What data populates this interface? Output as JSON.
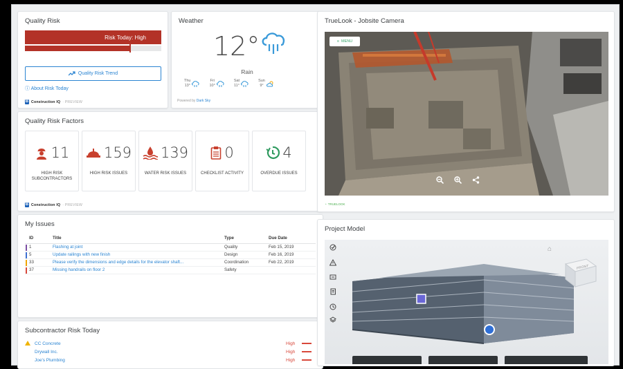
{
  "quality_risk": {
    "title": "Quality Risk",
    "risk_label": "Risk Today: High",
    "risk_level_fraction": 0.77,
    "trend_button": "Quality Risk Trend",
    "about_link": "About Risk Today",
    "footer_brand": "Construction IQ",
    "footer_tag": "· PREVIEW"
  },
  "weather": {
    "title": "Weather",
    "temperature": "12°",
    "condition": "Rain",
    "forecast": [
      {
        "day": "Thu",
        "temp": "13°",
        "icon": "rain-cloud-icon"
      },
      {
        "day": "Fri",
        "temp": "10°",
        "icon": "rain-cloud-icon"
      },
      {
        "day": "Sat",
        "temp": "11°",
        "icon": "rain-cloud-icon"
      },
      {
        "day": "Sun",
        "temp": "9°",
        "icon": "partly-cloudy-icon"
      }
    ],
    "powered_prefix": "Powered by",
    "powered_brand": "Dark Sky"
  },
  "risk_factors": {
    "title": "Quality Risk Factors",
    "items": [
      {
        "value": "11",
        "label": "HIGH RISK SUBCONTRACTORS",
        "icon": "worker-icon"
      },
      {
        "value": "159",
        "label": "HIGH RISK ISSUES",
        "icon": "hard-hat-icon"
      },
      {
        "value": "139",
        "label": "WATER RISK ISSUES",
        "icon": "water-risk-icon"
      },
      {
        "value": "0",
        "label": "CHECKLIST ACTIVITY",
        "icon": "clipboard-icon"
      },
      {
        "value": "4",
        "label": "OVERDUE ISSUES",
        "icon": "overdue-icon"
      }
    ],
    "footer_brand": "Construction IQ",
    "footer_tag": "· PREVIEW"
  },
  "camera": {
    "title": "TrueLook - Jobsite Camera",
    "menu_label": "MENU",
    "footer_brand": "TRUELOOK"
  },
  "my_issues": {
    "title": "My Issues",
    "columns": [
      "ID",
      "Title",
      "Type",
      "Due Date"
    ],
    "rows": [
      {
        "id": "1",
        "title": "Flashing at joint",
        "type": "Quality",
        "due": "Feb 15, 2019",
        "color": "#7b4ea3"
      },
      {
        "id": "5",
        "title": "Update railings with new finish",
        "type": "Design",
        "due": "Feb 16, 2019",
        "color": "#3c6fd1"
      },
      {
        "id": "33",
        "title": "Please verify the dimensions and edge details for the elevator shaft...",
        "type": "Coordination",
        "due": "Feb 22, 2019",
        "color": "#f0a500"
      },
      {
        "id": "37",
        "title": "Missing handrails on floor 2",
        "type": "Safety",
        "due": "",
        "color": "#d8473a"
      }
    ]
  },
  "subcontractor_risk": {
    "title": "Subcontractor Risk Today",
    "rows": [
      {
        "name": "CC Concrete",
        "level": "High",
        "warning": true
      },
      {
        "name": "Drywall Inc.",
        "level": "High",
        "warning": false
      },
      {
        "name": "Joe's Plumbing",
        "level": "High",
        "warning": false
      }
    ]
  },
  "project_model": {
    "title": "Project Model",
    "cube_label": "FRONT",
    "tools": [
      "checkmark-icon",
      "warning-icon",
      "comment-icon",
      "document-icon",
      "clock-icon",
      "layers-icon"
    ]
  }
}
